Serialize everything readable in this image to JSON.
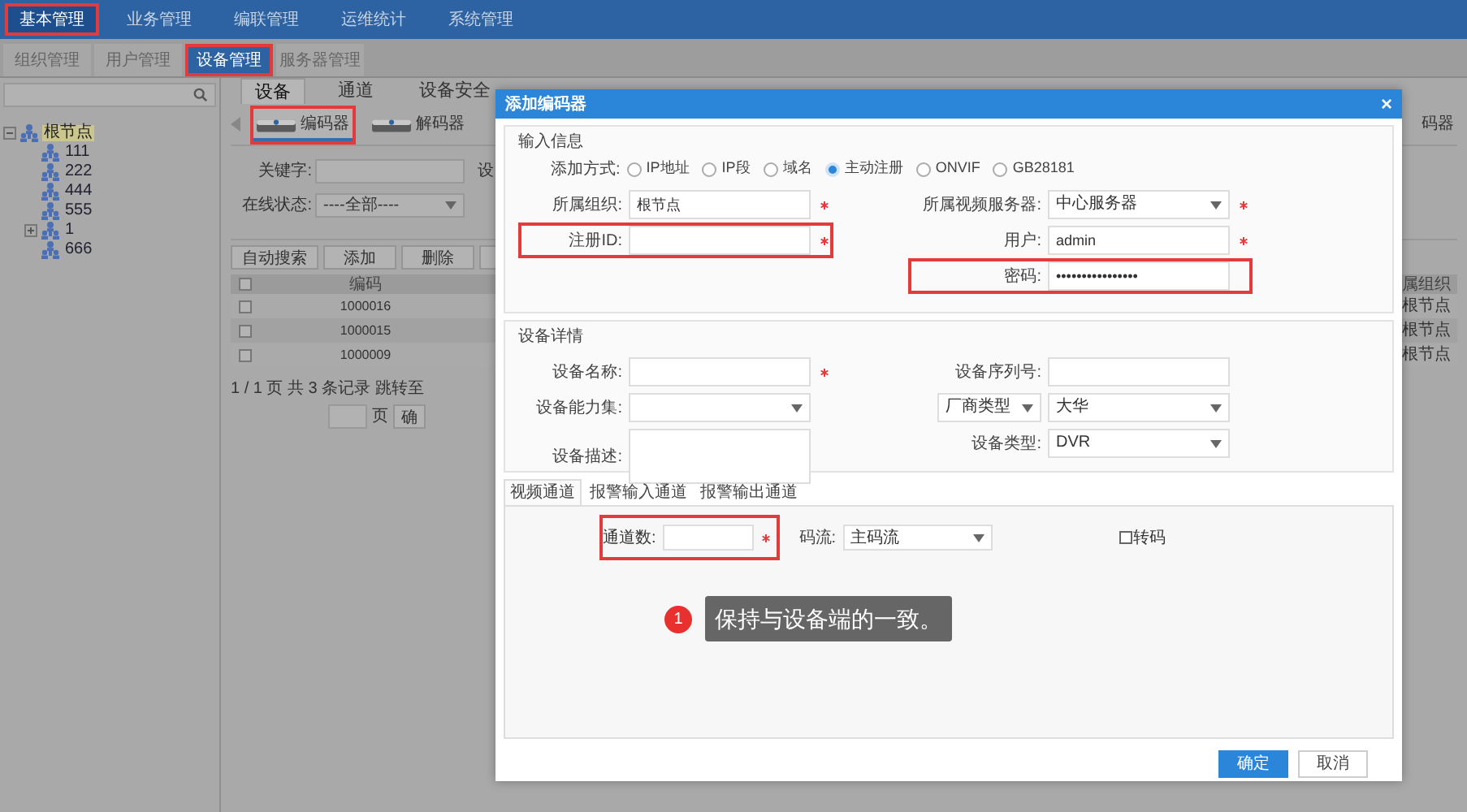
{
  "top_nav": [
    {
      "label": "基本管理",
      "selected": true,
      "highlighted": true
    },
    {
      "label": "业务管理",
      "selected": false,
      "highlighted": false
    },
    {
      "label": "编联管理",
      "selected": false,
      "highlighted": false
    },
    {
      "label": "运维统计",
      "selected": false,
      "highlighted": false
    },
    {
      "label": "系统管理",
      "selected": false,
      "highlighted": false
    }
  ],
  "sub_nav": [
    {
      "label": "组织管理",
      "selected": false,
      "highlighted": false
    },
    {
      "label": "用户管理",
      "selected": false,
      "highlighted": false
    },
    {
      "label": "设备管理",
      "selected": true,
      "highlighted": true
    },
    {
      "label": "服务器管理",
      "selected": false,
      "highlighted": false
    }
  ],
  "sidebar": {
    "tree": [
      {
        "label": "根节点",
        "selected": true,
        "expanded": true,
        "children": [
          {
            "label": "111",
            "selected": false
          },
          {
            "label": "222",
            "selected": false
          },
          {
            "label": "444",
            "selected": false
          },
          {
            "label": "555",
            "selected": false
          },
          {
            "label": "1",
            "selected": false,
            "expanded": false
          },
          {
            "label": "666",
            "selected": false
          }
        ]
      }
    ]
  },
  "main": {
    "tabs": [
      {
        "label": "设备",
        "selected": true
      },
      {
        "label": "通道",
        "selected": false
      },
      {
        "label": "设备安全",
        "selected": false
      }
    ],
    "device_types": [
      {
        "label": "编码器",
        "selected": true,
        "highlighted": true
      },
      {
        "label": "解码器",
        "selected": false,
        "highlighted": false
      }
    ],
    "device_type_cut": "码器",
    "filters": [
      {
        "kind": "text",
        "label": "关键字:"
      },
      {
        "kind": "select",
        "label": "在线状态:",
        "value": "----全部----"
      }
    ],
    "filter_cut": "设",
    "buttons": [
      "自动搜索",
      "添加",
      "删除"
    ],
    "table": {
      "all_checked": false,
      "columns": [
        "编码"
      ],
      "column_cut": "属组织",
      "rows": [
        {
          "checked": false,
          "code": "1000016",
          "column_cut": "根节点"
        },
        {
          "checked": false,
          "code": "1000015",
          "column_cut": "根节点"
        },
        {
          "checked": false,
          "code": "1000009",
          "column_cut": "根节点"
        }
      ]
    },
    "pager": {
      "info": "1 / 1 页 共 3 条记录 跳转至",
      "unit": "页",
      "button": "确"
    }
  },
  "dialog": {
    "title": "添加编码器",
    "close": "×",
    "input_section": {
      "legend": "输入信息",
      "mode_label": "添加方式:",
      "modes": [
        {
          "label": "IP地址",
          "selected": false
        },
        {
          "label": "IP段",
          "selected": false
        },
        {
          "label": "域名",
          "selected": false
        },
        {
          "label": "主动注册",
          "selected": true
        },
        {
          "label": "ONVIF",
          "selected": false
        },
        {
          "label": "GB28181",
          "selected": false
        }
      ],
      "left": [
        {
          "kind": "text",
          "label": "所属组织:",
          "value": "根节点",
          "required": true,
          "highlighted": false
        },
        {
          "kind": "text",
          "label": "注册ID:",
          "required": true,
          "highlighted": true
        }
      ],
      "right": [
        {
          "kind": "select",
          "label": "所属视频服务器:",
          "value": "中心服务器",
          "required": true,
          "highlighted": false
        },
        {
          "kind": "text",
          "label": "用户:",
          "value": "admin",
          "required": true,
          "highlighted": false
        },
        {
          "kind": "password",
          "label": "密码:",
          "value": "••••••••••••••••",
          "highlighted": true
        }
      ]
    },
    "detail_section": {
      "legend": "设备详情",
      "left": [
        {
          "kind": "text",
          "label": "设备名称:",
          "required": true,
          "highlighted": false
        },
        {
          "kind": "select",
          "label": "设备能力集:",
          "highlighted": false
        },
        {
          "kind": "textarea",
          "label": "设备描述:",
          "highlighted": false
        }
      ],
      "right": [
        {
          "kind": "text",
          "label": "设备序列号:",
          "highlighted": false
        },
        {
          "kind": "dual_select",
          "label": "厂商类型",
          "value": "大华",
          "highlighted": false
        },
        {
          "kind": "select",
          "label": "设备类型:",
          "value": "DVR",
          "highlighted": false
        }
      ]
    },
    "channel_tabs": [
      {
        "label": "视频通道",
        "selected": true
      },
      {
        "label": "报警输入通道",
        "selected": false
      },
      {
        "label": "报警输出通道",
        "selected": false
      }
    ],
    "channel_fields": {
      "count": {
        "label": "通道数:",
        "required": true,
        "highlighted": true
      },
      "stream": {
        "label": "码流:",
        "value": "主码流"
      },
      "transcode": {
        "label": "转码",
        "checked": false
      }
    },
    "callout": {
      "number": "1",
      "text": "保持与设备端的一致。"
    },
    "buttons": [
      {
        "label": "确定",
        "kind": "primary"
      },
      {
        "label": "取消",
        "kind": "secondary"
      }
    ]
  }
}
